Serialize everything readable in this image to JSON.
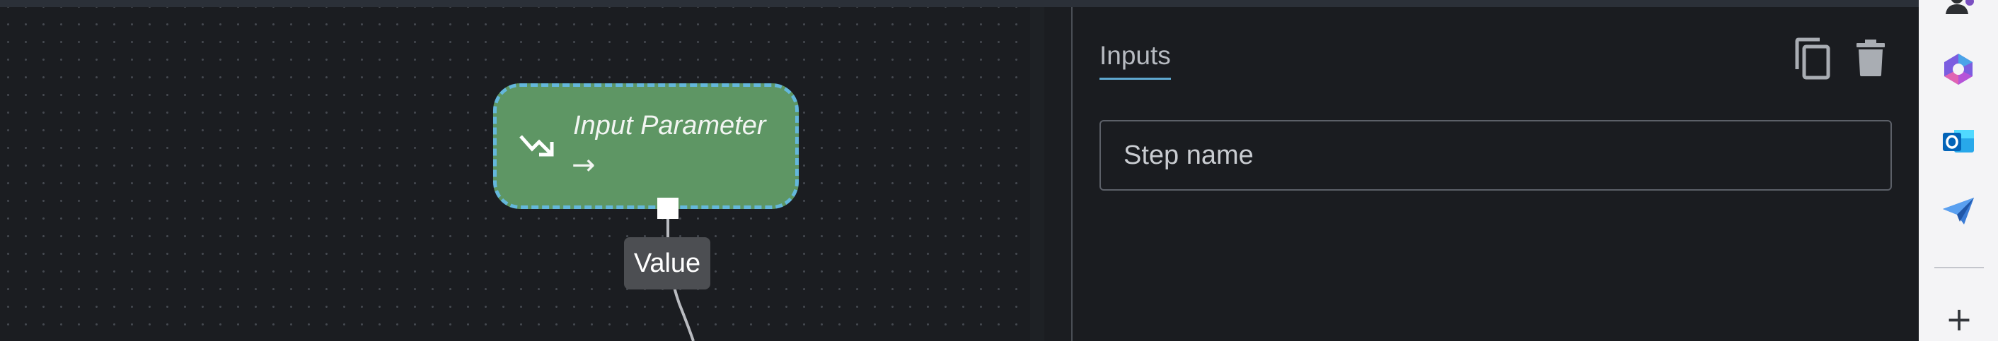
{
  "canvas": {
    "node": {
      "title": "Input Parameter",
      "arrow": "→",
      "icon": "trending-arrow-icon",
      "fill_color": "#5e9664",
      "selection_color": "#64b7db"
    },
    "edge_label": "Value"
  },
  "panel": {
    "tabs": [
      {
        "label": "Inputs",
        "active": true
      }
    ],
    "actions": {
      "copy_icon": "copy-icon",
      "delete_icon": "trash-icon"
    },
    "step_name": {
      "placeholder": "Step name",
      "value": ""
    },
    "accent_color": "#5fa8d0"
  },
  "sidebar": {
    "apps": [
      {
        "icon": "people-app-icon"
      },
      {
        "icon": "copilot-icon"
      },
      {
        "icon": "outlook-icon"
      },
      {
        "icon": "send-plane-icon"
      }
    ],
    "add_label": "+"
  }
}
